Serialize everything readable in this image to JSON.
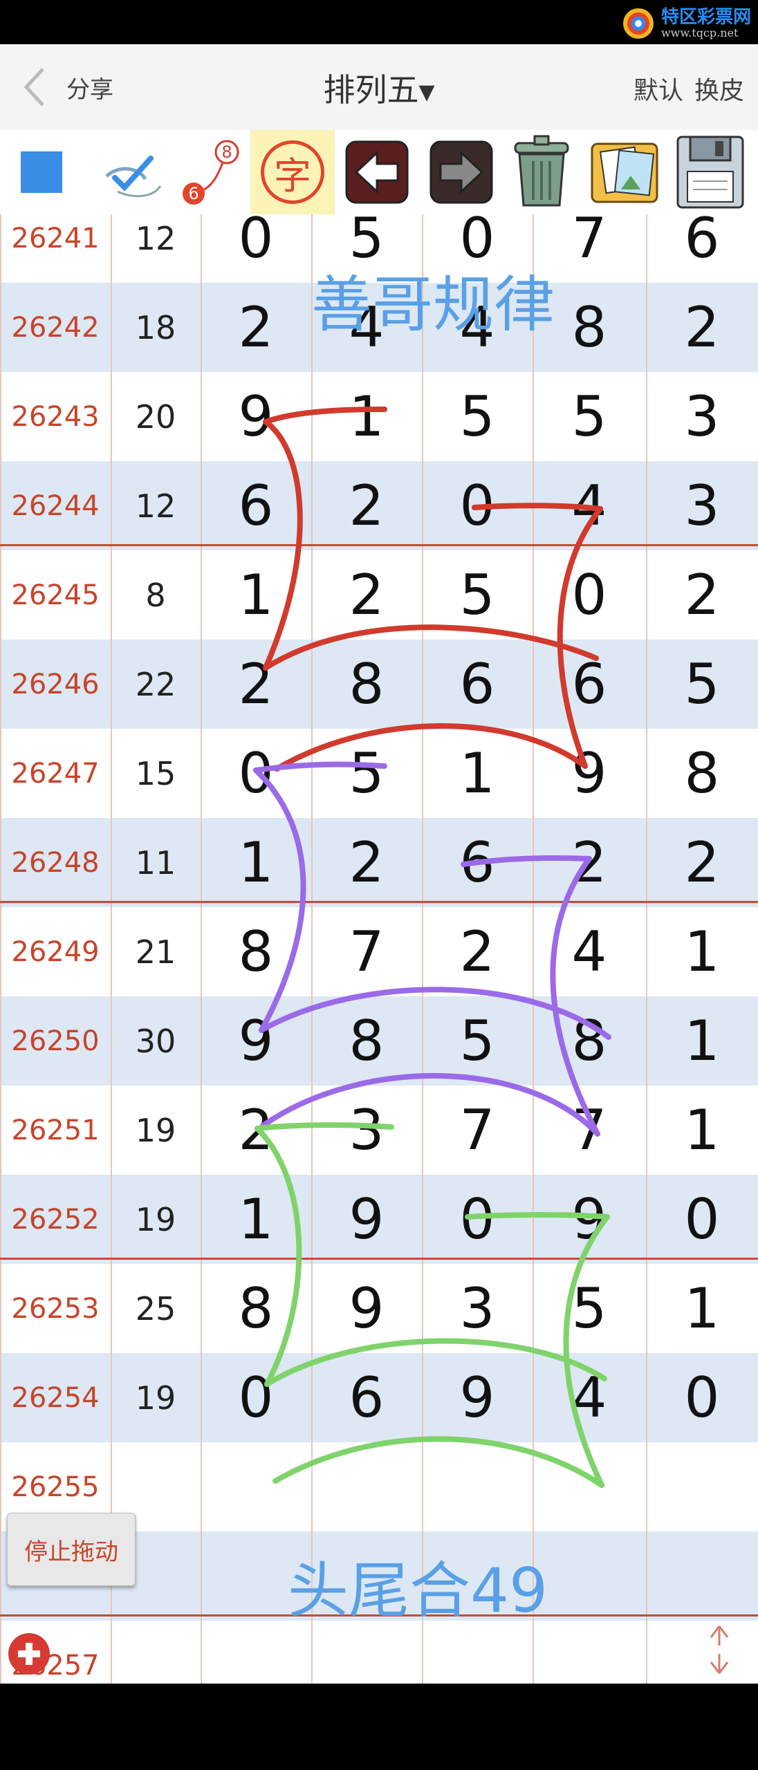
{
  "logo": {
    "title": "特区彩票网",
    "url": "www.tqcp.net"
  },
  "nav": {
    "share": "分享",
    "title": "排列五",
    "menu_default": "默认",
    "menu_skin": "换皮"
  },
  "toolbar": {
    "icons": [
      "blue-square-icon",
      "pen-check-icon",
      "link-6-8-icon",
      "zi-character-icon",
      "back-arrow-icon",
      "forward-arrow-icon",
      "trash-can-icon",
      "photo-album-icon",
      "floppy-disk-icon"
    ],
    "badge_top": "8",
    "badge_bottom": "6",
    "zi": "字"
  },
  "rows": [
    {
      "issue": "26241",
      "sum": "12",
      "d": [
        "0",
        "5",
        "0",
        "7",
        "6"
      ]
    },
    {
      "issue": "26242",
      "sum": "18",
      "d": [
        "2",
        "4",
        "4",
        "8",
        "2"
      ]
    },
    {
      "issue": "26243",
      "sum": "20",
      "d": [
        "9",
        "1",
        "5",
        "5",
        "3"
      ]
    },
    {
      "issue": "26244",
      "sum": "12",
      "d": [
        "6",
        "2",
        "0",
        "4",
        "3"
      ]
    },
    {
      "issue": "26245",
      "sum": "8",
      "d": [
        "1",
        "2",
        "5",
        "0",
        "2"
      ]
    },
    {
      "issue": "26246",
      "sum": "22",
      "d": [
        "2",
        "8",
        "6",
        "6",
        "5"
      ]
    },
    {
      "issue": "26247",
      "sum": "15",
      "d": [
        "0",
        "5",
        "1",
        "9",
        "8"
      ]
    },
    {
      "issue": "26248",
      "sum": "11",
      "d": [
        "1",
        "2",
        "6",
        "2",
        "2"
      ]
    },
    {
      "issue": "26249",
      "sum": "21",
      "d": [
        "8",
        "7",
        "2",
        "4",
        "1"
      ]
    },
    {
      "issue": "26250",
      "sum": "30",
      "d": [
        "9",
        "8",
        "5",
        "8",
        "1"
      ]
    },
    {
      "issue": "26251",
      "sum": "19",
      "d": [
        "2",
        "3",
        "7",
        "7",
        "1"
      ]
    },
    {
      "issue": "26252",
      "sum": "19",
      "d": [
        "1",
        "9",
        "0",
        "9",
        "0"
      ]
    },
    {
      "issue": "26253",
      "sum": "25",
      "d": [
        "8",
        "9",
        "3",
        "5",
        "1"
      ]
    },
    {
      "issue": "26254",
      "sum": "19",
      "d": [
        "0",
        "6",
        "9",
        "4",
        "0"
      ]
    },
    {
      "issue": "26255",
      "sum": "",
      "d": [
        "",
        "",
        "",
        "",
        ""
      ]
    },
    {
      "issue": "26256",
      "sum": "",
      "d": [
        "",
        "",
        "",
        "",
        ""
      ]
    },
    {
      "issue": "26257",
      "sum": "",
      "d": [
        "",
        "",
        "",
        "",
        ""
      ]
    }
  ],
  "annotations": {
    "top": "善哥规律",
    "bottom": "头尾合49"
  },
  "buttons": {
    "stop_drag": "停止拖动"
  },
  "colors": {
    "issue": "#c8442a",
    "red_stroke": "#d13a2c",
    "purple_stroke": "#9b6ae8",
    "green_stroke": "#7fd36a",
    "annotation": "#5aa0e6"
  }
}
